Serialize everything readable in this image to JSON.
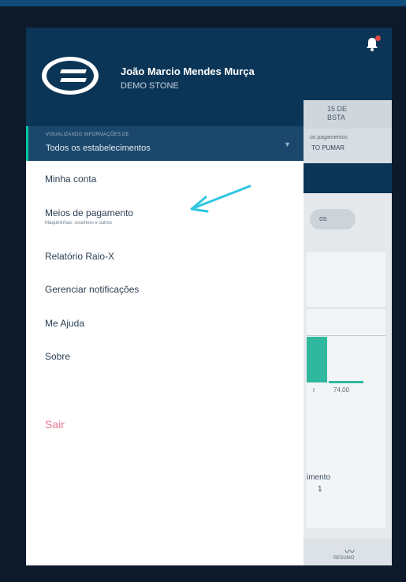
{
  "drawer": {
    "user_name": "João Marcio Mendes Murça",
    "company": "DEMO STONE",
    "selector_caption": "VISUALIZANDO INFORMAÇÕES DE",
    "selector_value": "Todos os estabelecimentos",
    "menu": [
      {
        "label": "Minha conta"
      },
      {
        "label": "Meios de pagamento",
        "sublabel": "Maquininhas, vouchers e outros"
      },
      {
        "label": "Relatório Raio-X"
      },
      {
        "label": "Gerenciar notificações"
      },
      {
        "label": "Me Ajuda"
      },
      {
        "label": "Sobre"
      }
    ],
    "logout_label": "Sair"
  },
  "background": {
    "row1_text": "15 DE\nBSTA",
    "row2_caption": "os pagamentos",
    "row2_value": "TO PUMAR",
    "pill_text": "os",
    "chart_label_1": "r",
    "chart_label_2": "74,00",
    "bottom_text_1": "imento",
    "bottom_text_2": "1",
    "nav_label": "RESUMO"
  },
  "colors": {
    "header": "#0b3556",
    "accent": "#00c89b",
    "logout": "#e87a94",
    "annotation_arrow": "#2ec6e0"
  },
  "icons": [
    "bell-icon",
    "stone-logo-icon",
    "chevron-down-icon",
    "annotation-arrow-icon",
    "activity-icon"
  ]
}
